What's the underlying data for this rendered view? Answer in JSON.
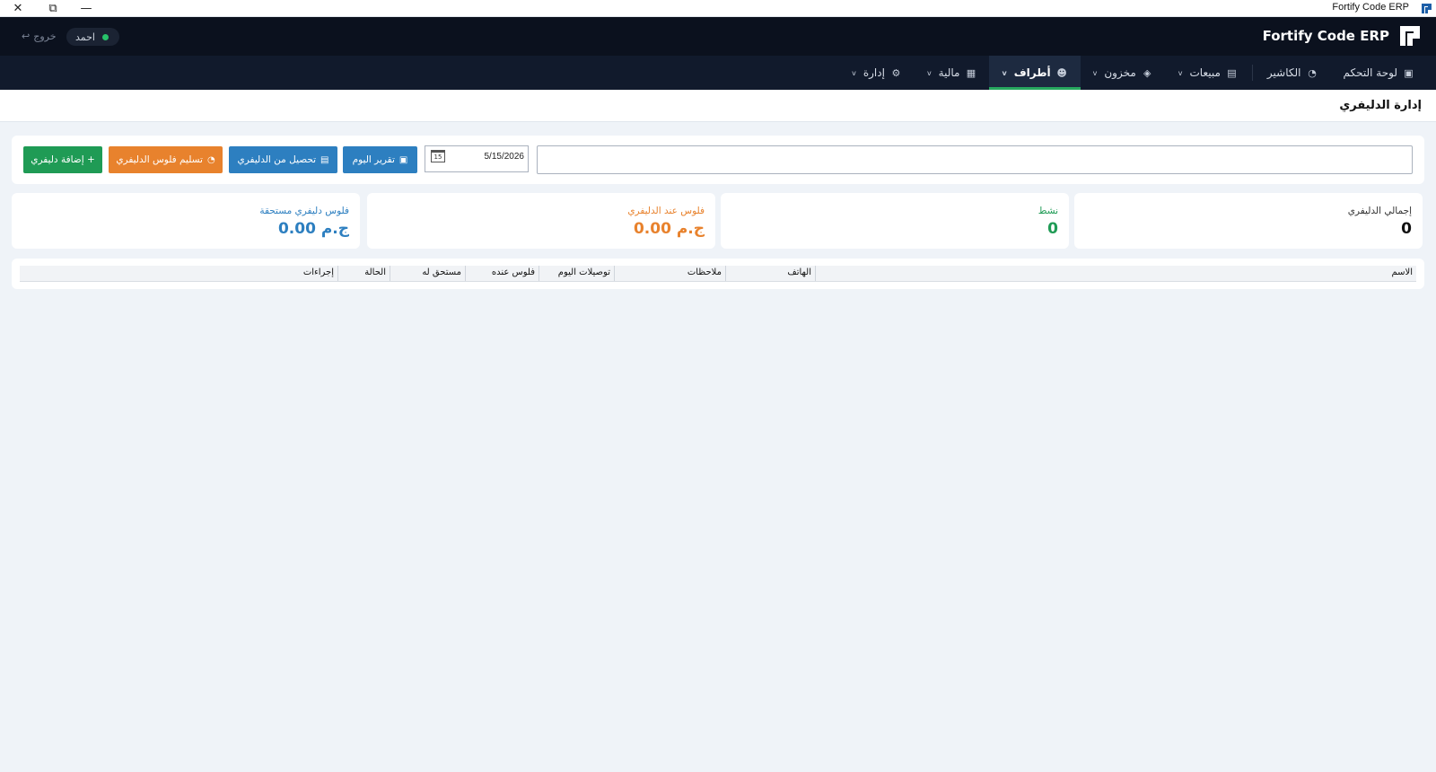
{
  "window": {
    "title": "Fortify Code ERP",
    "close_glyph": "✕",
    "restore_glyph": "⧉",
    "minimize_glyph": "—"
  },
  "header": {
    "brand": "Fortify Code ERP",
    "user_name": "احمد",
    "logout_label": "خروج",
    "logout_icon": "↩"
  },
  "nav": {
    "items": [
      {
        "label": "لوحة التحكم",
        "icon": "dashboard-icon",
        "glyph": "▣",
        "active": false,
        "dropdown": false
      },
      {
        "label": "الكاشير",
        "icon": "cashier-icon",
        "glyph": "◔",
        "active": false,
        "dropdown": false
      },
      {
        "label": "مبيعات",
        "icon": "receipt-icon",
        "glyph": "▤",
        "active": false,
        "dropdown": true
      },
      {
        "label": "مخزون",
        "icon": "box-icon",
        "glyph": "◈",
        "active": false,
        "dropdown": true
      },
      {
        "label": "أطراف",
        "icon": "people-icon",
        "glyph": "☻",
        "active": true,
        "dropdown": true
      },
      {
        "label": "مالية",
        "icon": "finance-icon",
        "glyph": "▦",
        "active": false,
        "dropdown": true
      },
      {
        "label": "إدارة",
        "icon": "gear-icon",
        "glyph": "⚙",
        "active": false,
        "dropdown": true
      }
    ],
    "caret": "v"
  },
  "page": {
    "title": "إدارة الدليفري"
  },
  "toolbar": {
    "search_value": "",
    "date_value": "5/15/2026",
    "calendar_day": "15",
    "report_label": "تقرير اليوم",
    "collect_label": "تحصيل من الدليفري",
    "deliver_label": "تسليم فلوس الدليفري",
    "add_label": "+ إضافة دليفري"
  },
  "stats": [
    {
      "label": "إجمالي الدليفري",
      "value": "0",
      "color": "#111111"
    },
    {
      "label": "نشط",
      "value": "0",
      "color": "#1f9b55"
    },
    {
      "label": "فلوس عند الدليفري",
      "value": "0.00 ج.م",
      "color": "#e8822d"
    },
    {
      "label": "فلوس دليفري مستحقة",
      "value": "0.00 ج.م",
      "color": "#2d7fc0"
    }
  ],
  "table": {
    "columns": [
      "الاسم",
      "الهاتف",
      "ملاحظات",
      "توصيلات اليوم",
      "فلوس عنده",
      "مستحق له",
      "الحالة",
      "إجراءات"
    ]
  },
  "colors": {
    "green": "#1f9b55",
    "orange": "#e8822d",
    "blue": "#2d7fc0",
    "header_bg": "#0b111e",
    "nav_bg": "#111a2c"
  }
}
